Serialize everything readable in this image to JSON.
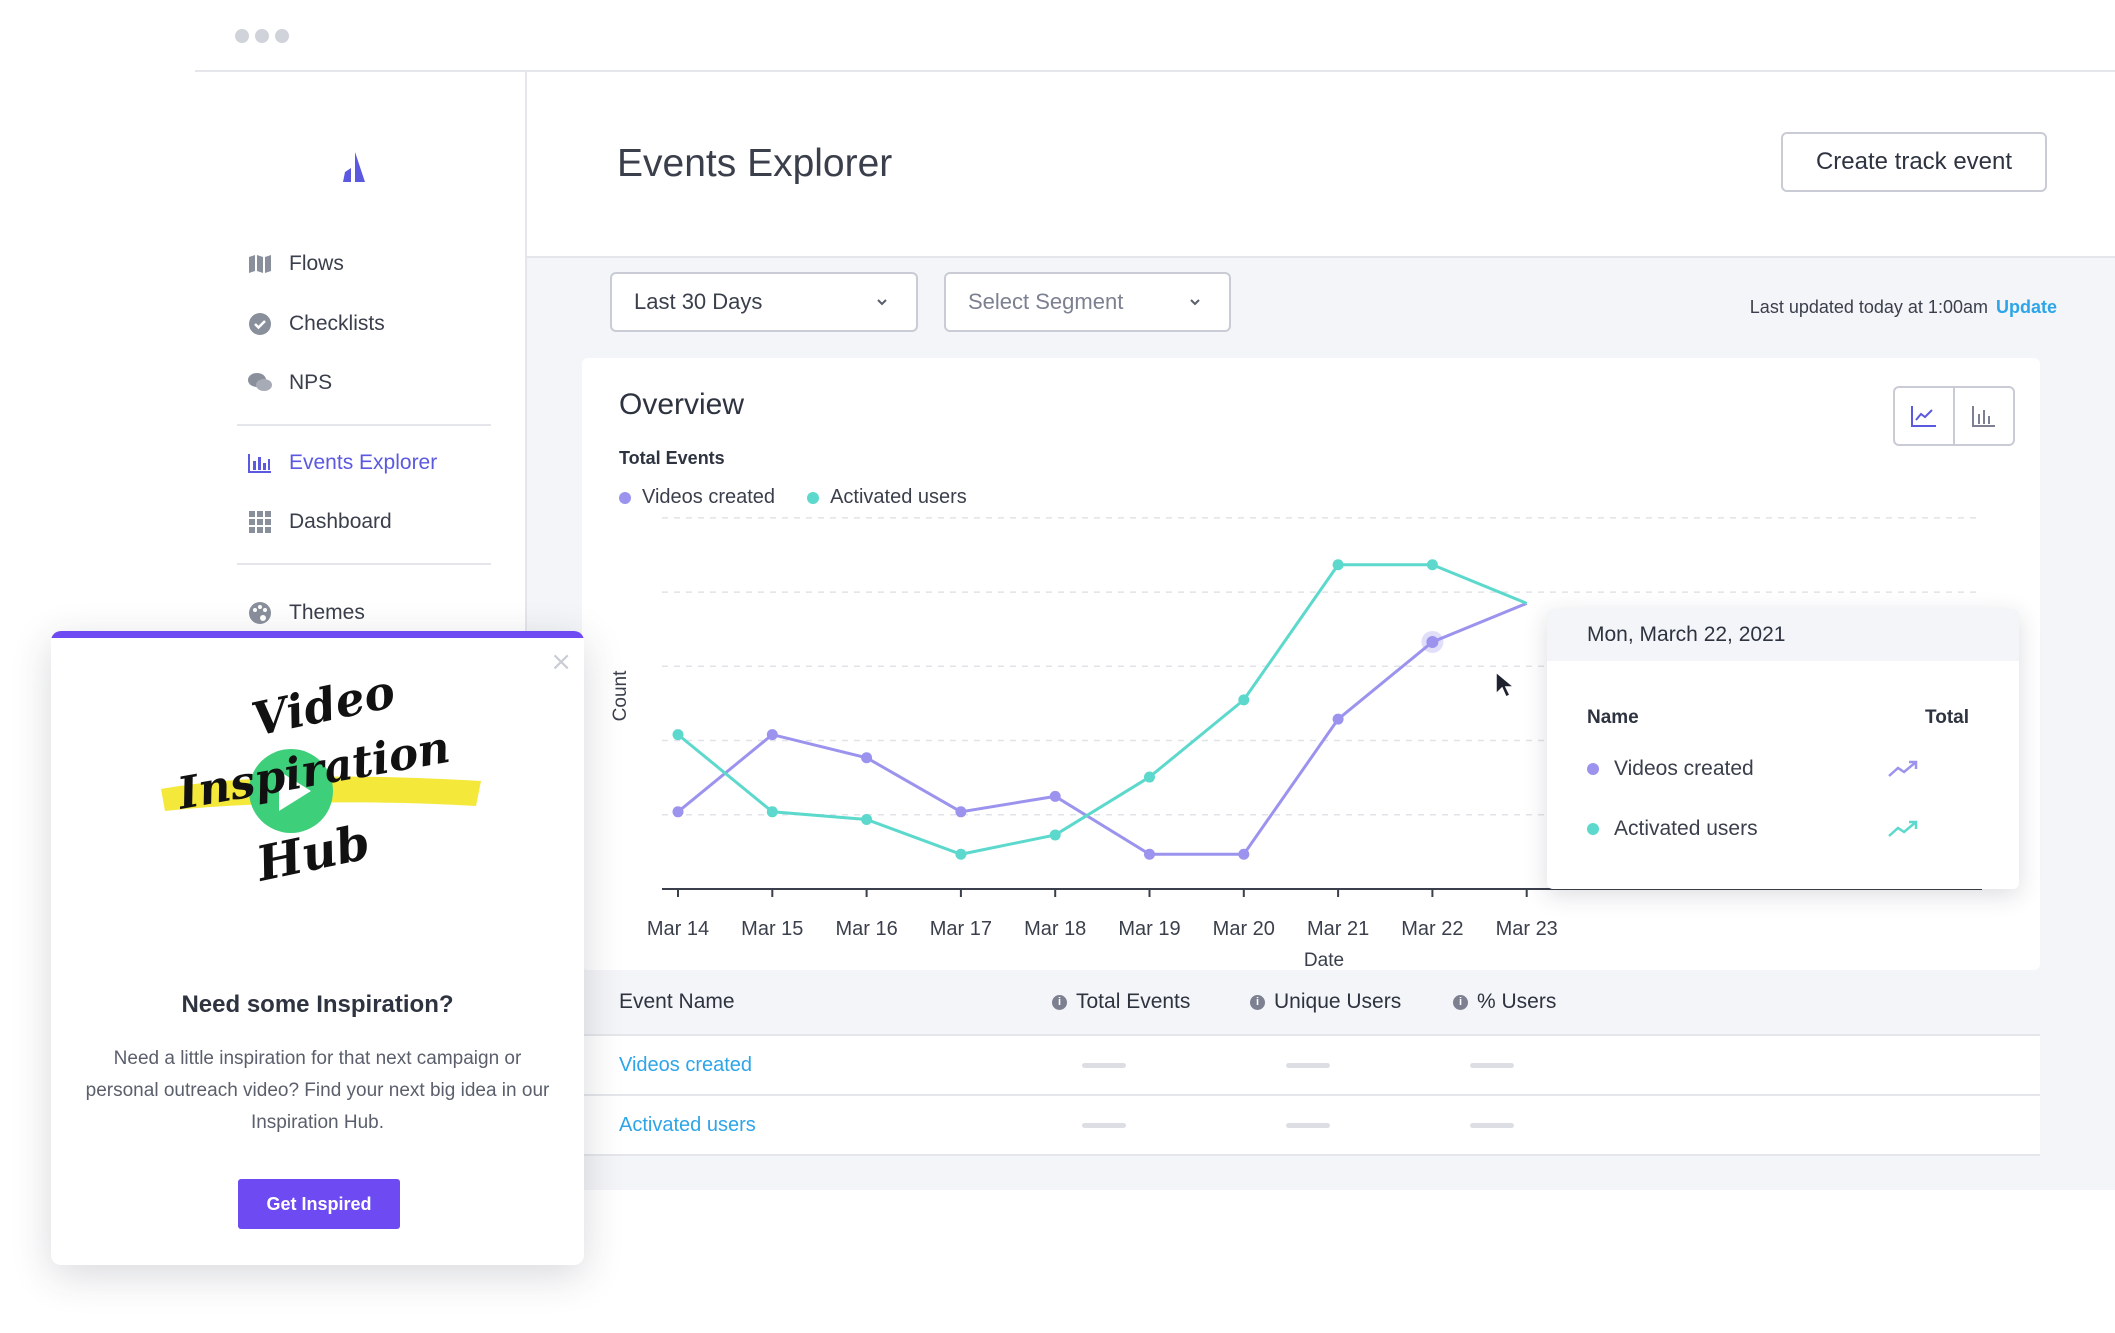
{
  "header": {
    "title": "Events Explorer",
    "create_button": "Create track event"
  },
  "sidebar": {
    "items": [
      {
        "label": "Flows",
        "icon": "map-icon",
        "active": false
      },
      {
        "label": "Checklists",
        "icon": "check-circle-icon",
        "active": false
      },
      {
        "label": "NPS",
        "icon": "chat-bubbles-icon",
        "active": false
      },
      {
        "label": "Events Explorer",
        "icon": "bar-chart-icon",
        "active": true
      },
      {
        "label": "Dashboard",
        "icon": "grid-icon",
        "active": false
      },
      {
        "label": "Themes",
        "icon": "palette-icon",
        "active": false
      }
    ]
  },
  "filters": {
    "date_range": "Last 30 Days",
    "segment_placeholder": "Select Segment",
    "last_updated": "Last updated today at 1:00am",
    "update_link": "Update"
  },
  "overview": {
    "title": "Overview"
  },
  "colors": {
    "accent": "#5b59e0",
    "videos": "#9b93ee",
    "activated": "#5cd9cc",
    "link": "#2da5e8",
    "popup_button": "#6d4af2"
  },
  "chart_data": {
    "type": "line",
    "title": "Total Events",
    "xlabel": "Date",
    "ylabel": "Count",
    "categories": [
      "Mar 14",
      "Mar 15",
      "Mar 16",
      "Mar 17",
      "Mar 18",
      "Mar 19",
      "Mar 20",
      "Mar 21",
      "Mar 22",
      "Mar 23"
    ],
    "series": [
      {
        "name": "Videos created",
        "color": "#9b93ee",
        "values": [
          1.0,
          2.0,
          1.7,
          1.0,
          1.2,
          0.45,
          0.45,
          2.2,
          3.2,
          3.7
        ]
      },
      {
        "name": "Activated users",
        "color": "#5cd9cc",
        "values": [
          2.0,
          1.0,
          0.9,
          0.45,
          0.7,
          1.45,
          2.45,
          4.2,
          4.2,
          3.7
        ]
      }
    ],
    "ylim": [
      0,
      5
    ],
    "grid": true,
    "legend": "top-left"
  },
  "tooltip": {
    "date": "Mon, March 22, 2021",
    "name_header": "Name",
    "total_header": "Total",
    "rows": [
      {
        "name": "Videos created",
        "trend_icon": "trend-up-icon"
      },
      {
        "name": "Activated users",
        "trend_icon": "trend-up-icon"
      }
    ]
  },
  "table": {
    "headers": [
      "Event Name",
      "Total Events",
      "Unique Users",
      "% Users"
    ],
    "rows": [
      {
        "name": "Videos created"
      },
      {
        "name": "Activated users"
      }
    ]
  },
  "popup": {
    "heading": "Need some Inspiration?",
    "body": "Need a little inspiration for that next campaign or personal outreach video? Find your next big idea in our Inspiration Hub.",
    "button": "Get Inspired",
    "close": "×",
    "logo_text": "Video Inspiration Hub"
  }
}
